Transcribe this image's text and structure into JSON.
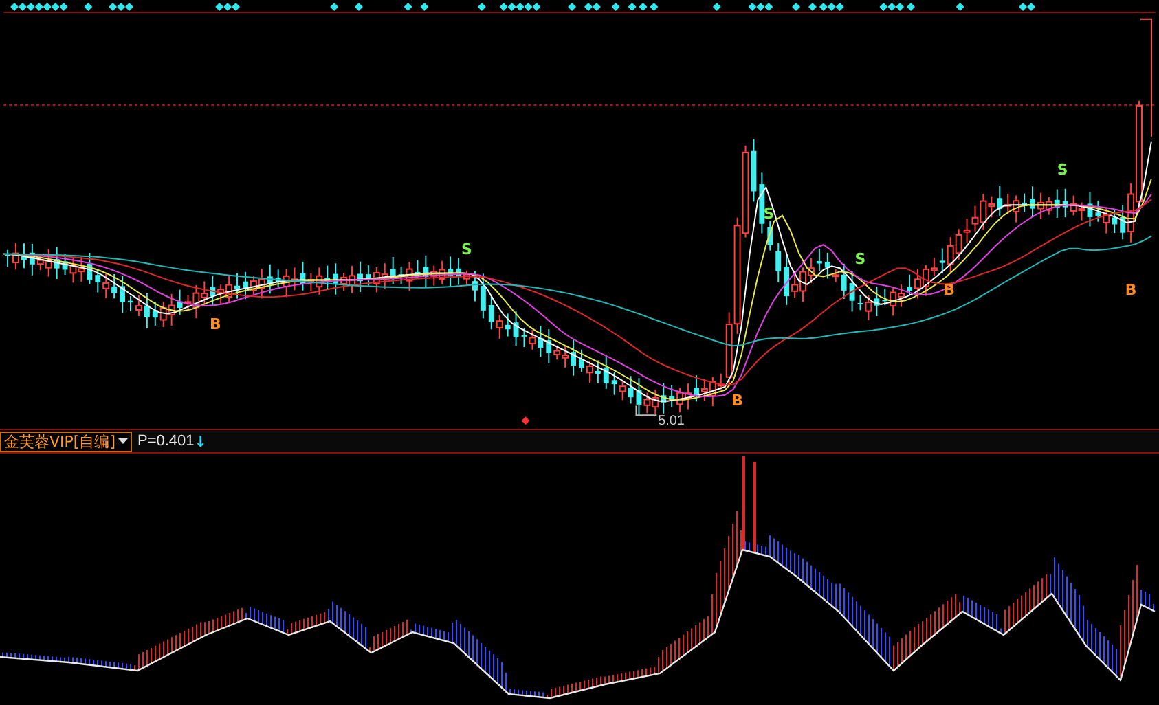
{
  "price_chart": {
    "low_label": "5.01",
    "signals": [
      {
        "kind": "buy",
        "label": "B"
      },
      {
        "kind": "sell",
        "label": "S"
      },
      {
        "kind": "buy",
        "label": "B"
      },
      {
        "kind": "sell",
        "label": "S"
      },
      {
        "kind": "sell",
        "label": "S"
      },
      {
        "kind": "buy",
        "label": "B"
      },
      {
        "kind": "sell",
        "label": "S"
      },
      {
        "kind": "buy",
        "label": "B"
      }
    ]
  },
  "indicator_bar": {
    "name": "金芙蓉VIP[自编]",
    "reading": "P=0.401",
    "trend_arrow": "↓"
  }
}
